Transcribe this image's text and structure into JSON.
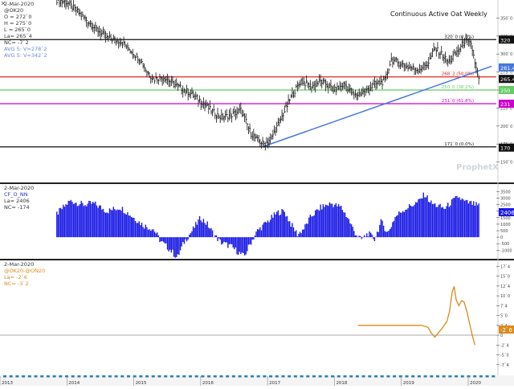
{
  "panel1": {
    "header": [
      "2-Mar-2020",
      "@OK20",
      "O = 272`0",
      "H = 275`0",
      "L = 265`0",
      "La= 265`4",
      "NC= -7`2"
    ],
    "avg_labels": [
      "AVG 5: V=278`2",
      "AVG 5: V=342`2"
    ],
    "title": "Continuous Active Oat Weekly",
    "watermark": "ProphetX",
    "line_labels": [
      "320`0 (0.0%)",
      "268`2 (50.0%)",
      "250`0 (38.2%)",
      "231`0 (61.8%)",
      "171`0 (0.0%)"
    ],
    "badges": [
      "320",
      "281.4",
      "265.4",
      "250",
      "231",
      "170"
    ]
  },
  "panel2": {
    "header": [
      "2-Mar-2020",
      "CF_O_NN",
      "La= 2406",
      "NC= -174"
    ],
    "badge": "2406"
  },
  "panel3": {
    "header": [
      "2-Mar-2020",
      "@OK20-@ON20",
      "La= -2`6",
      "NC= -3`2"
    ],
    "badge": "-2`6"
  },
  "xaxis": {
    "years": [
      "2013",
      "2014",
      "2015",
      "2016",
      "2017",
      "2018",
      "2019",
      "2020"
    ]
  },
  "chart_data": [
    {
      "type": "candlestick",
      "title": "Continuous Active Oat Weekly",
      "ylim": [
        125,
        375
      ],
      "ticks": [
        "150`0",
        "175`0",
        "200`0",
        "225`0",
        "250`0",
        "275`0",
        "300`0",
        "325`0",
        "350`0",
        "375`0"
      ],
      "tick_values": [
        150,
        175,
        200,
        225,
        250,
        275,
        300,
        325,
        350,
        375
      ],
      "x_start": 2013.85,
      "x_end": 2020.15,
      "anchors": [
        [
          2013.85,
          375
        ],
        [
          2014.0,
          372
        ],
        [
          2014.2,
          355
        ],
        [
          2014.4,
          338
        ],
        [
          2014.6,
          322
        ],
        [
          2014.8,
          318
        ],
        [
          2014.95,
          305
        ],
        [
          2015.1,
          292
        ],
        [
          2015.2,
          275
        ],
        [
          2015.3,
          265
        ],
        [
          2015.45,
          268
        ],
        [
          2015.6,
          258
        ],
        [
          2015.8,
          248
        ],
        [
          2016.0,
          235
        ],
        [
          2016.15,
          222
        ],
        [
          2016.3,
          212
        ],
        [
          2016.45,
          215
        ],
        [
          2016.6,
          222
        ],
        [
          2016.75,
          190
        ],
        [
          2016.85,
          180
        ],
        [
          2016.95,
          175
        ],
        [
          2017.05,
          182
        ],
        [
          2017.2,
          210
        ],
        [
          2017.35,
          240
        ],
        [
          2017.5,
          263
        ],
        [
          2017.65,
          255
        ],
        [
          2017.8,
          262
        ],
        [
          2018.0,
          250
        ],
        [
          2018.15,
          258
        ],
        [
          2018.3,
          242
        ],
        [
          2018.45,
          248
        ],
        [
          2018.6,
          258
        ],
        [
          2018.75,
          262
        ],
        [
          2018.85,
          292
        ],
        [
          2018.95,
          288
        ],
        [
          2019.1,
          282
        ],
        [
          2019.25,
          278
        ],
        [
          2019.4,
          287
        ],
        [
          2019.5,
          308
        ],
        [
          2019.6,
          300
        ],
        [
          2019.7,
          288
        ],
        [
          2019.85,
          305
        ],
        [
          2019.95,
          318
        ],
        [
          2020.05,
          312
        ],
        [
          2020.15,
          265
        ]
      ],
      "hlines": [
        {
          "value": 320,
          "label": "320`0 (0.0%)",
          "color": "#111111"
        },
        {
          "value": 268.2,
          "label": "268`2 (50.0%)",
          "color": "#dd1111"
        },
        {
          "value": 250,
          "label": "250`0 (38.2%)",
          "color": "#66cc66"
        },
        {
          "value": 231,
          "label": "231`0 (61.8%)",
          "color": "#cc00cc"
        },
        {
          "value": 171,
          "label": "171`0 (0.0%)",
          "color": "#111111"
        }
      ],
      "trendline": {
        "from": [
          2016.95,
          172
        ],
        "to": [
          2020.35,
          283
        ],
        "color": "#4477dd"
      }
    },
    {
      "type": "bar",
      "title": "CF_O_NN",
      "ylim": [
        -1600,
        3900
      ],
      "ticks": [
        "3500",
        "3000",
        "2500",
        "2000",
        "1500",
        "1000",
        "500",
        "0",
        "-500",
        "-1000"
      ],
      "tick_values": [
        3500,
        3000,
        2500,
        2000,
        1500,
        1000,
        500,
        0,
        -500,
        -1000
      ],
      "anchors": [
        [
          2013.85,
          1800
        ],
        [
          2014.05,
          2800
        ],
        [
          2014.25,
          2500
        ],
        [
          2014.4,
          2600
        ],
        [
          2014.6,
          2000
        ],
        [
          2014.8,
          2300
        ],
        [
          2015.0,
          1500
        ],
        [
          2015.15,
          900
        ],
        [
          2015.3,
          600
        ],
        [
          2015.4,
          -300
        ],
        [
          2015.55,
          -1000
        ],
        [
          2015.65,
          -1600
        ],
        [
          2015.75,
          -400
        ],
        [
          2015.9,
          700
        ],
        [
          2016.0,
          1500
        ],
        [
          2016.1,
          1000
        ],
        [
          2016.2,
          200
        ],
        [
          2016.3,
          -400
        ],
        [
          2016.45,
          -700
        ],
        [
          2016.55,
          -1100
        ],
        [
          2016.65,
          -1500
        ],
        [
          2016.75,
          -400
        ],
        [
          2016.85,
          500
        ],
        [
          2017.0,
          1200
        ],
        [
          2017.15,
          1900
        ],
        [
          2017.25,
          2000
        ],
        [
          2017.35,
          1000
        ],
        [
          2017.45,
          200
        ],
        [
          2017.55,
          700
        ],
        [
          2017.65,
          1600
        ],
        [
          2017.8,
          2300
        ],
        [
          2017.95,
          2600
        ],
        [
          2018.1,
          2300
        ],
        [
          2018.2,
          1500
        ],
        [
          2018.3,
          400
        ],
        [
          2018.4,
          -200
        ],
        [
          2018.5,
          300
        ],
        [
          2018.6,
          -150
        ],
        [
          2018.7,
          1200
        ],
        [
          2018.8,
          300
        ],
        [
          2018.9,
          1500
        ],
        [
          2019.0,
          2000
        ],
        [
          2019.1,
          2300
        ],
        [
          2019.25,
          2700
        ],
        [
          2019.35,
          3300
        ],
        [
          2019.45,
          2600
        ],
        [
          2019.55,
          2400
        ],
        [
          2019.65,
          2200
        ],
        [
          2019.75,
          2700
        ],
        [
          2019.85,
          3100
        ],
        [
          2019.95,
          2700
        ],
        [
          2020.05,
          2600
        ],
        [
          2020.15,
          2406
        ]
      ],
      "color": "#1a1ae6"
    },
    {
      "type": "line",
      "title": "@OK20-@ON20",
      "ylim": [
        -10,
        18.4
      ],
      "ticks": [
        "17`4",
        "15`0",
        "12`4",
        "10`0",
        "7`4",
        "5`0",
        "2`4",
        "0",
        "-2`4",
        "-5`0",
        "-7`4"
      ],
      "tick_values": [
        17.5,
        15,
        12.5,
        10,
        7.5,
        5,
        2.5,
        0,
        -2.5,
        -5,
        -7.5
      ],
      "hline": 0,
      "anchors": [
        [
          2018.35,
          2.5
        ],
        [
          2018.6,
          2.5
        ],
        [
          2018.8,
          2.5
        ],
        [
          2019.0,
          2.5
        ],
        [
          2019.15,
          2.5
        ],
        [
          2019.3,
          2.5
        ],
        [
          2019.4,
          2.0
        ],
        [
          2019.45,
          0.5
        ],
        [
          2019.5,
          -0.5
        ],
        [
          2019.55,
          0.5
        ],
        [
          2019.62,
          2.0
        ],
        [
          2019.68,
          3.5
        ],
        [
          2019.72,
          6.0
        ],
        [
          2019.76,
          11.0
        ],
        [
          2019.79,
          12.4
        ],
        [
          2019.82,
          9.0
        ],
        [
          2019.86,
          7.5
        ],
        [
          2019.9,
          8.8
        ],
        [
          2019.94,
          8.4
        ],
        [
          2019.98,
          6.0
        ],
        [
          2020.02,
          3.0
        ],
        [
          2020.06,
          0.0
        ],
        [
          2020.1,
          -2.5
        ]
      ],
      "color": "#d98a1a"
    }
  ]
}
